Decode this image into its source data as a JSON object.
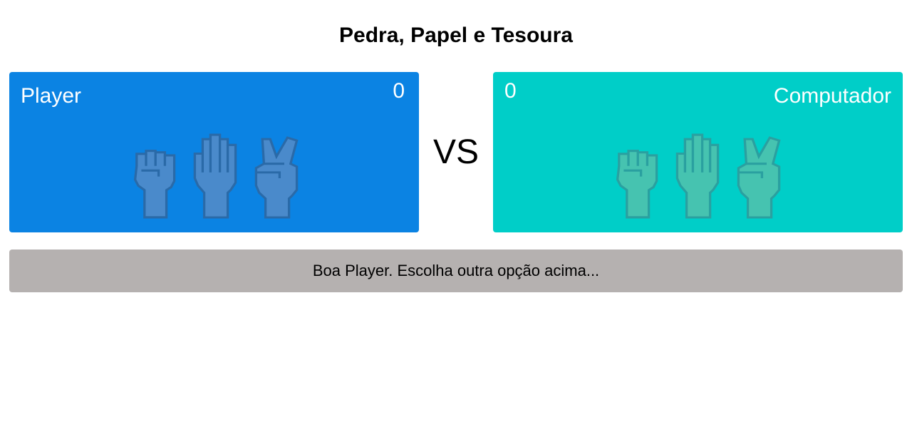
{
  "game": {
    "title": "Pedra, Papel e Tesoura",
    "vs_label": "VS",
    "message": "Boa Player. Escolha outra opção acima..."
  },
  "player": {
    "name": "Player",
    "score": "0",
    "color": "#0b83e3",
    "choices": [
      "rock-icon",
      "paper-icon",
      "scissors-icon"
    ]
  },
  "computer": {
    "name": "Computador",
    "score": "0",
    "color": "#00cec8",
    "choices": [
      "rock-icon",
      "paper-icon",
      "scissors-icon"
    ]
  },
  "colors": {
    "message_bg": "#b5b1b0",
    "hand_fill_player": "#4a8acb",
    "hand_fill_computer": "#46c3b0",
    "hand_outline": "#2a6aa8"
  }
}
